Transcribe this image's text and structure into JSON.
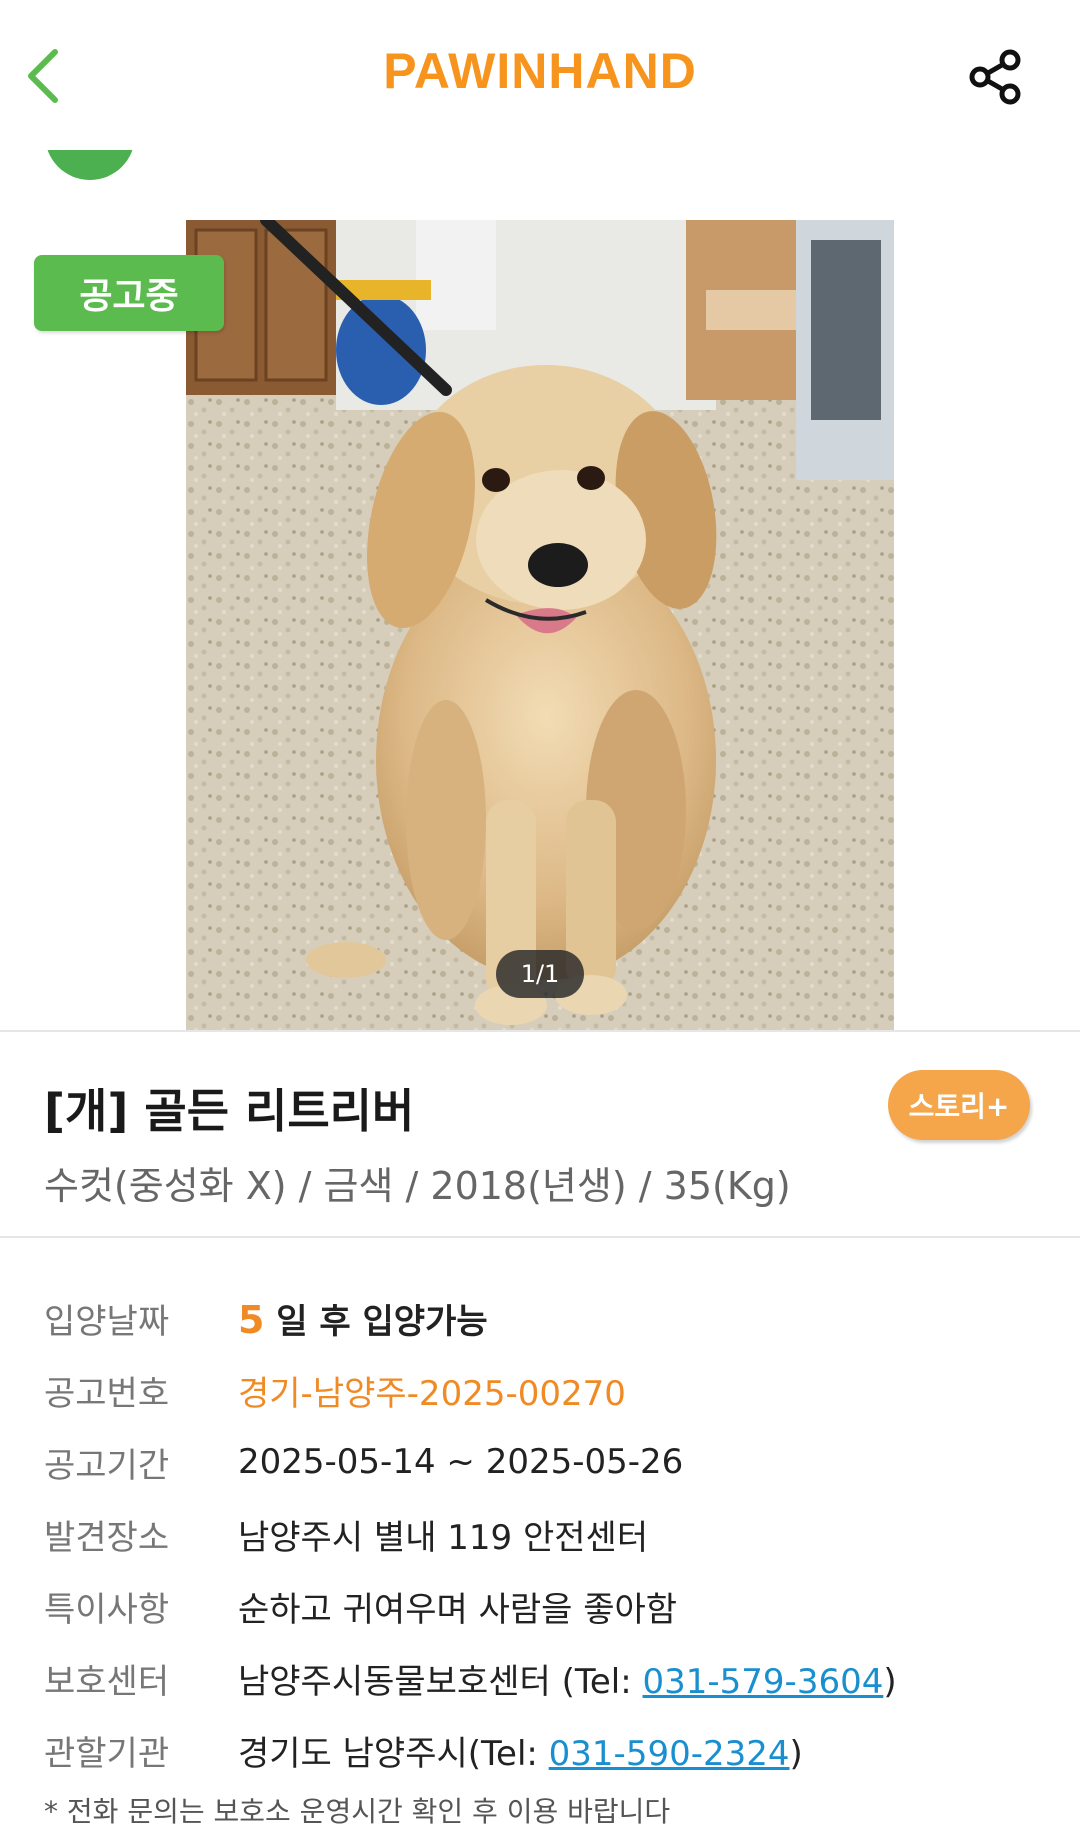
{
  "header": {
    "brand": "PAWINHAND",
    "brand_color": "#f7941d",
    "back_icon": "chevron-left-icon",
    "share_icon": "share-icon",
    "accent_green": "#5cbb4e"
  },
  "photo": {
    "status_badge": "공고중",
    "page_indicator": "1/1"
  },
  "animal": {
    "title": "[개] 골든 리트리버",
    "summary": "수컷(중성화 X) / 금색 / 2018(년생) / 35(Kg)",
    "story_button": "스토리+"
  },
  "details": {
    "adoption": {
      "label": "입양날짜",
      "days": "5",
      "text": "일 후 입양가능"
    },
    "notice_no": {
      "label": "공고번호",
      "value": "경기-남양주-2025-00270"
    },
    "period": {
      "label": "공고기간",
      "value": "2025-05-14 ~ 2025-05-26"
    },
    "found_place": {
      "label": "발견장소",
      "value": "남양주시 별내 119 안전센터"
    },
    "features": {
      "label": "특이사항",
      "value": "순하고 귀여우며 사람을 좋아함"
    },
    "shelter": {
      "label": "보호센터",
      "prefix": "남양주시동물보호센터 (Tel: ",
      "phone": "031-579-3604",
      "suffix": ")"
    },
    "agency": {
      "label": "관할기관",
      "prefix": "경기도 남양주시(Tel: ",
      "phone": "031-590-2324",
      "suffix": ")"
    }
  },
  "footnote": "* 전화 문의는 보호소 운영시간 확인 후 이용 바랍니다"
}
